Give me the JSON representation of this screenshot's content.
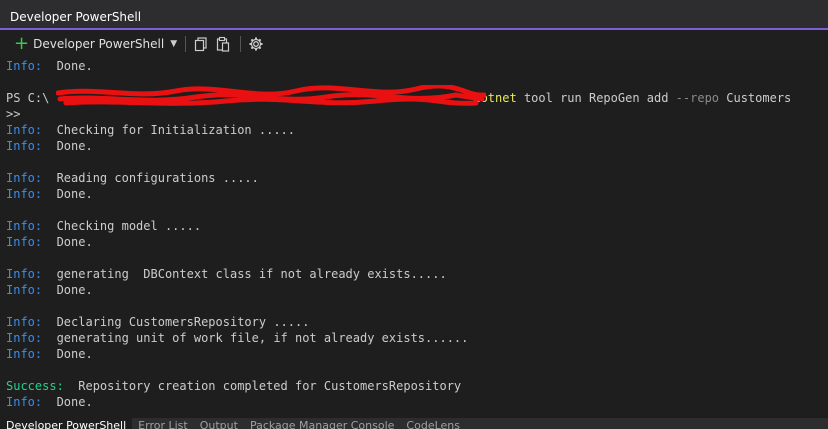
{
  "window": {
    "title": "Developer PowerShell"
  },
  "toolbar": {
    "new_terminal_label": "Developer PowerShell"
  },
  "icons": {
    "add": "plus-icon",
    "copy": "copy-icon",
    "paste": "paste-icon",
    "settings": "gear-icon"
  },
  "colors": {
    "accent": "#7a5fd6",
    "info": "#3b8eea",
    "success": "#23d18b",
    "command": "#e8e85a",
    "background": "#1e1e1e"
  },
  "terminal": {
    "lines": [
      {
        "type": "info",
        "tag": "Info:",
        "text": "  Done."
      },
      {
        "type": "blank"
      },
      {
        "type": "prompt",
        "prefix": "PS C:\\",
        "command": "dotnet",
        "args_a": "tool run RepoGen add ",
        "param": "--repo",
        "args_b": " Customers"
      },
      {
        "type": "plain",
        "text": ">>"
      },
      {
        "type": "info",
        "tag": "Info:",
        "text": "  Checking for Initialization ....."
      },
      {
        "type": "info",
        "tag": "Info:",
        "text": "  Done."
      },
      {
        "type": "blank"
      },
      {
        "type": "info",
        "tag": "Info:",
        "text": "  Reading configurations ....."
      },
      {
        "type": "info",
        "tag": "Info:",
        "text": "  Done."
      },
      {
        "type": "blank"
      },
      {
        "type": "info",
        "tag": "Info:",
        "text": "  Checking model ....."
      },
      {
        "type": "info",
        "tag": "Info:",
        "text": "  Done."
      },
      {
        "type": "blank"
      },
      {
        "type": "info",
        "tag": "Info:",
        "text": "  generating  DBContext class if not already exists....."
      },
      {
        "type": "info",
        "tag": "Info:",
        "text": "  Done."
      },
      {
        "type": "blank"
      },
      {
        "type": "info",
        "tag": "Info:",
        "text": "  Declaring CustomersRepository ....."
      },
      {
        "type": "info",
        "tag": "Info:",
        "text": "  generating unit of work file, if not already exists......"
      },
      {
        "type": "info",
        "tag": "Info:",
        "text": "  Done."
      },
      {
        "type": "blank"
      },
      {
        "type": "success",
        "tag": "Success:",
        "text": "  Repository creation completed for CustomersRepository"
      },
      {
        "type": "info",
        "tag": "Info:",
        "text": "  Done."
      }
    ]
  },
  "bottom_tabs": [
    "Developer PowerShell",
    "Error List",
    "Output",
    "Package Manager Console",
    "CodeLens"
  ]
}
